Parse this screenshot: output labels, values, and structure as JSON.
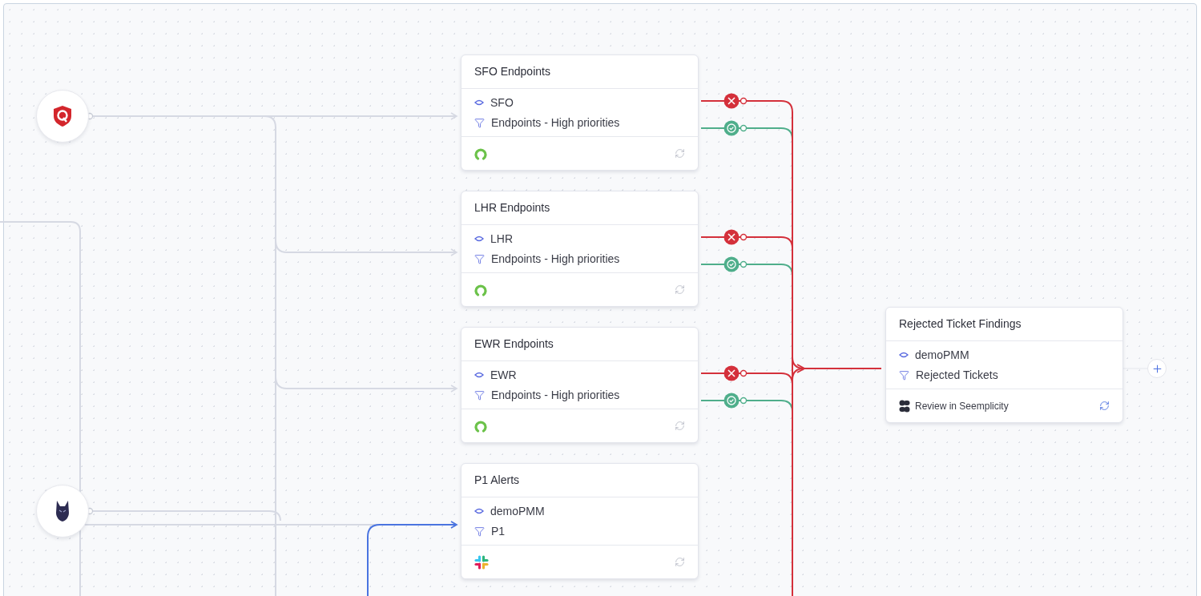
{
  "sources": [
    {
      "kind": "shield"
    },
    {
      "kind": "wolf"
    }
  ],
  "cards": [
    {
      "title": "SFO Endpoints",
      "rows": [
        {
          "kind": "source",
          "text": "SFO"
        },
        {
          "kind": "filter",
          "text": "Endpoints - High priorities"
        }
      ],
      "footer": {
        "kind": "ring"
      }
    },
    {
      "title": "LHR Endpoints",
      "rows": [
        {
          "kind": "source",
          "text": "LHR"
        },
        {
          "kind": "filter",
          "text": "Endpoints - High priorities"
        }
      ],
      "footer": {
        "kind": "ring"
      }
    },
    {
      "title": "EWR Endpoints",
      "rows": [
        {
          "kind": "source",
          "text": "EWR"
        },
        {
          "kind": "filter",
          "text": "Endpoints - High priorities"
        }
      ],
      "footer": {
        "kind": "ring"
      }
    },
    {
      "title": "P1 Alerts",
      "rows": [
        {
          "kind": "source",
          "text": "demoPMM"
        },
        {
          "kind": "filter",
          "text": "P1"
        }
      ],
      "footer": {
        "kind": "hash"
      }
    },
    {
      "title": "Rejected Ticket Findings",
      "rows": [
        {
          "kind": "source",
          "text": "demoPMM"
        },
        {
          "kind": "filter",
          "text": "Rejected Tickets"
        }
      ],
      "footer": {
        "kind": "blob",
        "label": "Review in Seemplicity"
      }
    }
  ]
}
